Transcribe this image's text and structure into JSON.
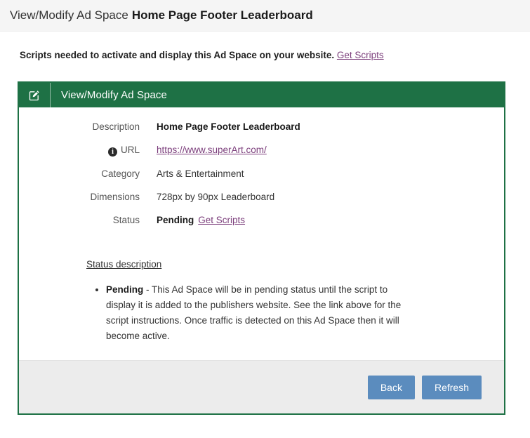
{
  "page_header": {
    "prefix": "View/Modify Ad Space",
    "title": "Home Page Footer Leaderboard"
  },
  "notice": {
    "text": "Scripts needed to activate and display this Ad Space on your website.",
    "link_label": "Get Scripts"
  },
  "panel": {
    "icon": "edit-icon",
    "title": "View/Modify Ad Space",
    "fields": [
      {
        "label": "Description",
        "value": "Home Page Footer Leaderboard"
      },
      {
        "label": "URL",
        "value": "https://www.superArt.com/",
        "icon": "info-icon"
      },
      {
        "label": "Category",
        "value": "Arts & Entertainment"
      },
      {
        "label": "Dimensions",
        "value": "728px by 90px Leaderboard"
      },
      {
        "label": "Status",
        "value": "Pending",
        "link_label": "Get Scripts"
      }
    ],
    "status_description": {
      "heading": "Status description",
      "items": [
        {
          "term": "Pending",
          "text": " - This Ad Space will be in pending status until the script to display it is added to the publishers website. See the link above for the script instructions. Once traffic is detected on this Ad Space then it will become active."
        }
      ]
    },
    "footer": {
      "back_label": "Back",
      "refresh_label": "Refresh"
    }
  },
  "colors": {
    "panel_green": "#1e7145",
    "button_blue": "#5b8cbe",
    "link_purple": "#7c3f7c",
    "footer_grey": "#ececec"
  }
}
